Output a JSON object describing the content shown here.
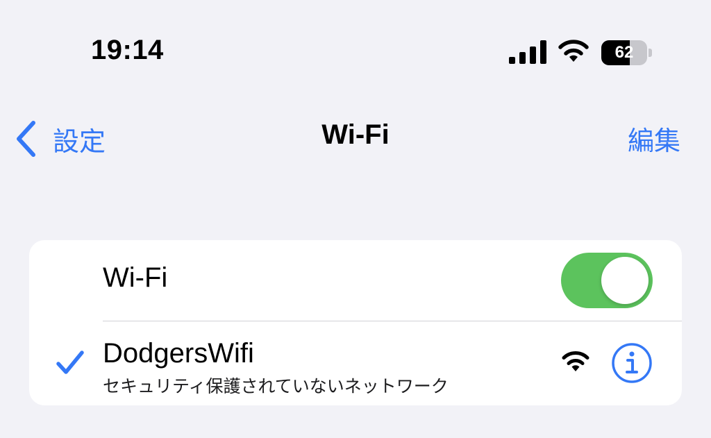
{
  "status_bar": {
    "time": "19:14",
    "signal_icon": "cellular-signal-icon",
    "wifi_icon": "wifi-icon",
    "battery_level": "62",
    "battery_fraction": 0.62
  },
  "nav": {
    "back_label": "設定",
    "title": "Wi-Fi",
    "edit_label": "編集"
  },
  "wifi_toggle": {
    "label": "Wi-Fi",
    "on": true,
    "on_color": "#5cc35d"
  },
  "current_network": {
    "name": "DodgersWifi",
    "subtitle": "セキュリティ保護されていないネットワーク",
    "connected": true
  },
  "colors": {
    "accent": "#3478f6",
    "background": "#f2f2f7"
  }
}
